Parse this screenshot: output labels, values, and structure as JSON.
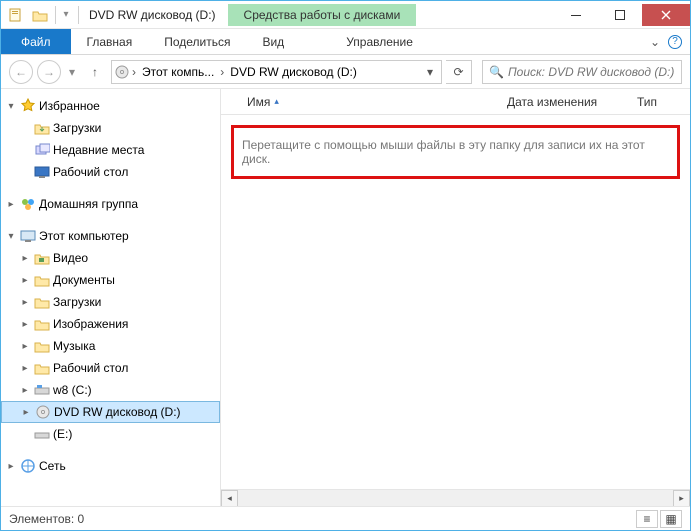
{
  "titlebar": {
    "title": "DVD RW дисковод (D:)",
    "context_tab": "Средства работы с дисками"
  },
  "ribbon": {
    "file": "Файл",
    "tabs": [
      "Главная",
      "Поделиться",
      "Вид"
    ],
    "context": "Управление"
  },
  "address": {
    "seg1": "Этот компь...",
    "seg2": "DVD RW дисковод (D:)"
  },
  "search": {
    "placeholder": "Поиск: DVD RW дисковод (D:)"
  },
  "columns": {
    "name": "Имя",
    "date": "Дата изменения",
    "type": "Тип"
  },
  "drop_hint": "Перетащите с помощью мыши файлы в эту папку для записи их на этот диск.",
  "sidebar": {
    "favorites": {
      "label": "Избранное",
      "items": [
        "Загрузки",
        "Недавние места",
        "Рабочий стол"
      ]
    },
    "homegroup": "Домашняя группа",
    "computer": {
      "label": "Этот компьютер",
      "items": [
        "Видео",
        "Документы",
        "Загрузки",
        "Изображения",
        "Музыка",
        "Рабочий стол",
        "w8 (C:)",
        "DVD RW дисковод (D:)",
        "(E:)"
      ]
    },
    "network": "Сеть"
  },
  "status": "Элементов: 0"
}
